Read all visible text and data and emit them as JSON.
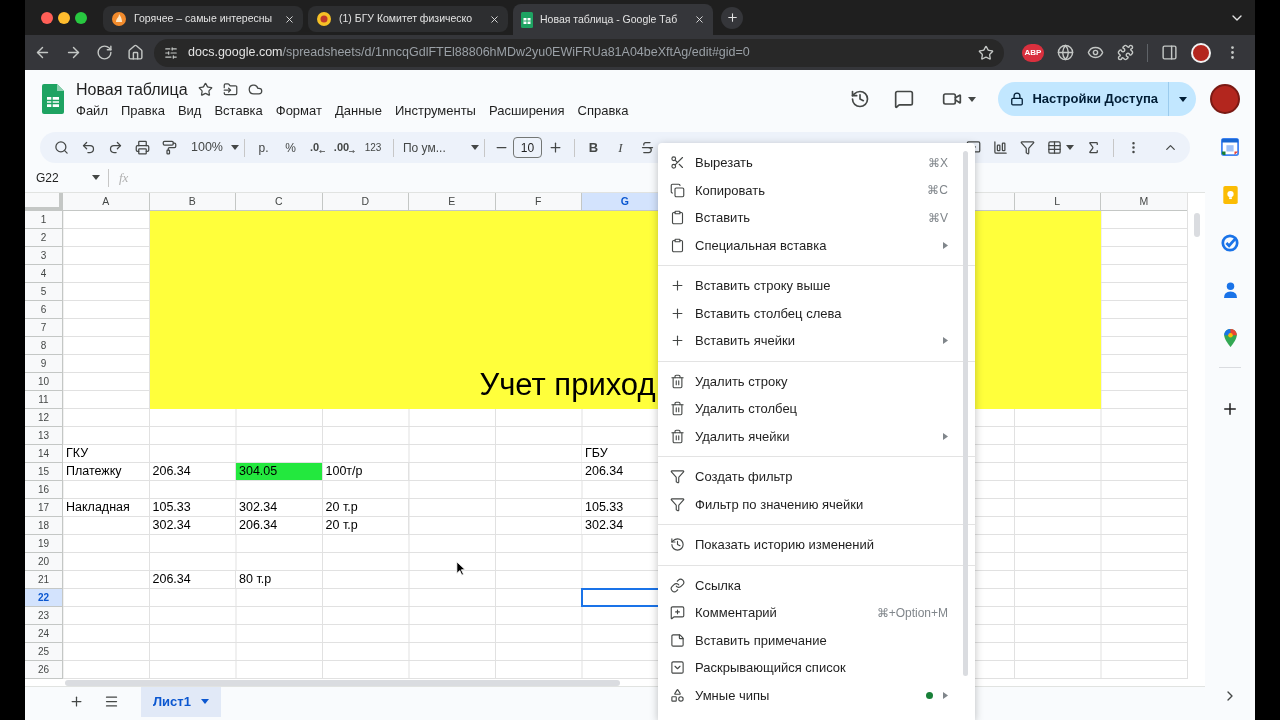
{
  "browser": {
    "tabs": [
      {
        "title": "Горячее – самые интересны",
        "selected": false
      },
      {
        "title": "(1) БГУ Комитет физическо",
        "selected": false
      },
      {
        "title": "Новая таблица - Google Таб",
        "selected": true
      }
    ],
    "address": {
      "host": "docs.google.com",
      "path": "/spreadsheets/d/1nncqGdlFTEl88806hMDw2yu0EWiFRUa81A04beXftAg/edit#gid=0"
    },
    "extension_badge": "ABP"
  },
  "document": {
    "title": "Новая таблица",
    "menus": [
      "Файл",
      "Правка",
      "Вид",
      "Вставка",
      "Формат",
      "Данные",
      "Инструменты",
      "Расширения",
      "Справка"
    ],
    "share_button": "Настройки Доступа"
  },
  "toolbar": {
    "zoom": "100%",
    "currency": "р.",
    "percent": "%",
    "decrease_decimals": ".0",
    "increase_decimals": ".00",
    "number_format": "123",
    "font": "По ум...",
    "font_size": "10",
    "bold": "B",
    "italic": "I"
  },
  "formula_bar": {
    "name_box": "G22",
    "fx": "fx"
  },
  "grid": {
    "columns_left": [
      {
        "label": "A",
        "selected": false
      },
      {
        "label": "B",
        "selected": false
      },
      {
        "label": "C",
        "selected": false
      },
      {
        "label": "D",
        "selected": false
      },
      {
        "label": "E",
        "selected": false
      },
      {
        "label": "F",
        "selected": false
      },
      {
        "label": "G",
        "selected": true
      }
    ],
    "columns_right": [
      {
        "label": "L",
        "selected": false
      },
      {
        "label": "M",
        "selected": false
      }
    ],
    "banner": "Учет приход",
    "rows": [
      {
        "number": "1",
        "selected": false
      },
      {
        "number": "2",
        "selected": false
      },
      {
        "number": "3",
        "selected": false
      },
      {
        "number": "4",
        "selected": false
      },
      {
        "number": "5",
        "selected": false
      },
      {
        "number": "6",
        "selected": false
      },
      {
        "number": "7",
        "selected": false
      },
      {
        "number": "8",
        "selected": false
      },
      {
        "number": "9",
        "selected": false
      },
      {
        "number": "10",
        "selected": false
      },
      {
        "number": "11",
        "selected": false
      },
      {
        "number": "12",
        "selected": false
      },
      {
        "number": "13",
        "selected": false
      },
      {
        "number": "14",
        "selected": false,
        "cells": {
          "A": {
            "text": "ГКУ"
          },
          "G": {
            "text": "ГБУ"
          }
        }
      },
      {
        "number": "15",
        "selected": false,
        "cells": {
          "A": {
            "text": "Платежку"
          },
          "B": {
            "text": "206.34"
          },
          "C": {
            "text": "304.05",
            "color": "#23e83e"
          },
          "D": {
            "text": "100т/р"
          },
          "G": {
            "text": "206.34"
          }
        }
      },
      {
        "number": "16",
        "selected": false
      },
      {
        "number": "17",
        "selected": false,
        "cells": {
          "A": {
            "text": "Накладная"
          },
          "B": {
            "text": "105.33"
          },
          "C": {
            "text": "302.34"
          },
          "D": {
            "text": "20 т.р"
          },
          "G": {
            "text": "105.33"
          }
        }
      },
      {
        "number": "18",
        "selected": false,
        "cells": {
          "B": {
            "text": "302.34"
          },
          "C": {
            "text": "206.34"
          },
          "D": {
            "text": "20 т.р"
          },
          "G": {
            "text": "302.34"
          }
        }
      },
      {
        "number": "19",
        "selected": false
      },
      {
        "number": "20",
        "selected": false
      },
      {
        "number": "21",
        "selected": false,
        "cells": {
          "B": {
            "text": "206.34"
          },
          "C": {
            "text": "80 т.р"
          }
        }
      },
      {
        "number": "22",
        "selected": true
      },
      {
        "number": "23",
        "selected": false
      },
      {
        "number": "24",
        "selected": false
      },
      {
        "number": "25",
        "selected": false
      },
      {
        "number": "26",
        "selected": false
      }
    ]
  },
  "sheets": [
    {
      "name": "Лист1",
      "selected": true
    }
  ],
  "context_menu": {
    "sections": [
      {
        "items": [
          {
            "label": "Вырезать",
            "shortcut": "⌘X",
            "submenu": false,
            "new_dot": false
          },
          {
            "label": "Копировать",
            "shortcut": "⌘C",
            "submenu": false,
            "new_dot": false
          },
          {
            "label": "Вставить",
            "shortcut": "⌘V",
            "submenu": false,
            "new_dot": false
          },
          {
            "label": "Специальная вставка",
            "submenu": true,
            "new_dot": false
          }
        ]
      },
      {
        "items": [
          {
            "label": "Вставить строку выше",
            "submenu": false,
            "new_dot": false
          },
          {
            "label": "Вставить столбец слева",
            "submenu": false,
            "new_dot": false
          },
          {
            "label": "Вставить ячейки",
            "submenu": true,
            "new_dot": false
          }
        ]
      },
      {
        "items": [
          {
            "label": "Удалить строку",
            "submenu": false,
            "new_dot": false
          },
          {
            "label": "Удалить столбец",
            "submenu": false,
            "new_dot": false
          },
          {
            "label": "Удалить ячейки",
            "submenu": true,
            "new_dot": false
          }
        ]
      },
      {
        "items": [
          {
            "label": "Создать фильтр",
            "submenu": false,
            "new_dot": false
          },
          {
            "label": "Фильтр по значению ячейки",
            "submenu": false,
            "new_dot": false
          }
        ]
      },
      {
        "items": [
          {
            "label": "Показать историю изменений",
            "submenu": false,
            "new_dot": false
          }
        ]
      },
      {
        "items": [
          {
            "label": "Ссылка",
            "submenu": false,
            "new_dot": false
          },
          {
            "label": "Комментарий",
            "shortcut": "⌘+Option+M",
            "submenu": false,
            "new_dot": false
          },
          {
            "label": "Вставить примечание",
            "submenu": false,
            "new_dot": false
          },
          {
            "label": "Раскрывающийся список",
            "submenu": false,
            "new_dot": false
          },
          {
            "label": "Умные чипы",
            "submenu": true,
            "new_dot": true
          }
        ]
      }
    ]
  }
}
